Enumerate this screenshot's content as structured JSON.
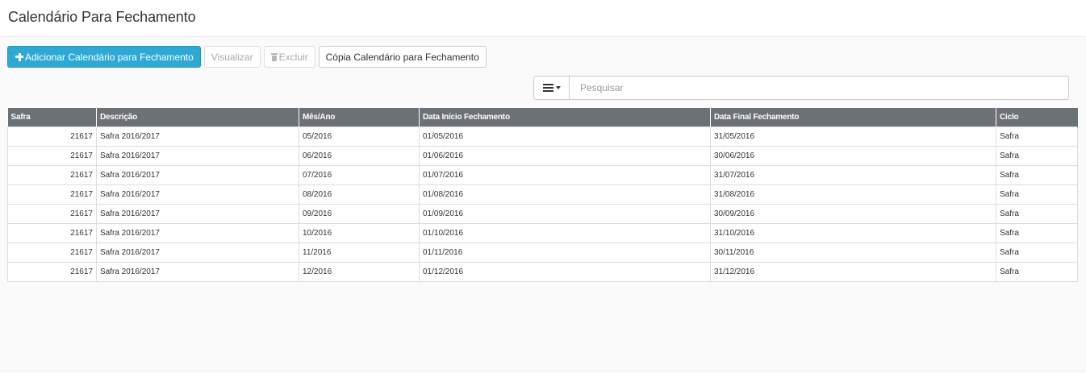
{
  "page": {
    "title": "Calendário Para Fechamento"
  },
  "toolbar": {
    "add_label": "Adicionar Calendário para Fechamento",
    "view_label": "Visualizar",
    "delete_label": "Excluir",
    "copy_label": "Cópia Calendário para Fechamento"
  },
  "search": {
    "placeholder": "Pesquisar",
    "value": ""
  },
  "table": {
    "headers": [
      "Safra",
      "Descrição",
      "Mês/Ano",
      "Data Início Fechamento",
      "Data Final Fechamento",
      "Ciclo"
    ],
    "rows": [
      [
        "21617",
        "Safra 2016/2017",
        "05/2016",
        "01/05/2016",
        "31/05/2016",
        "Safra"
      ],
      [
        "21617",
        "Safra 2016/2017",
        "06/2016",
        "01/06/2016",
        "30/06/2016",
        "Safra"
      ],
      [
        "21617",
        "Safra 2016/2017",
        "07/2016",
        "01/07/2016",
        "31/07/2016",
        "Safra"
      ],
      [
        "21617",
        "Safra 2016/2017",
        "08/2016",
        "01/08/2016",
        "31/08/2016",
        "Safra"
      ],
      [
        "21617",
        "Safra 2016/2017",
        "09/2016",
        "01/09/2016",
        "30/09/2016",
        "Safra"
      ],
      [
        "21617",
        "Safra 2016/2017",
        "10/2016",
        "01/10/2016",
        "31/10/2016",
        "Safra"
      ],
      [
        "21617",
        "Safra 2016/2017",
        "11/2016",
        "01/11/2016",
        "30/11/2016",
        "Safra"
      ],
      [
        "21617",
        "Safra 2016/2017",
        "12/2016",
        "01/12/2016",
        "31/12/2016",
        "Safra"
      ]
    ]
  },
  "colors": {
    "primary_button": "#2ea9d6",
    "table_header": "#6c7175"
  },
  "icons": {
    "add": "plus-icon",
    "delete": "trash-icon",
    "menu": "hamburger-menu-icon",
    "dropdown": "caret-down-icon"
  }
}
